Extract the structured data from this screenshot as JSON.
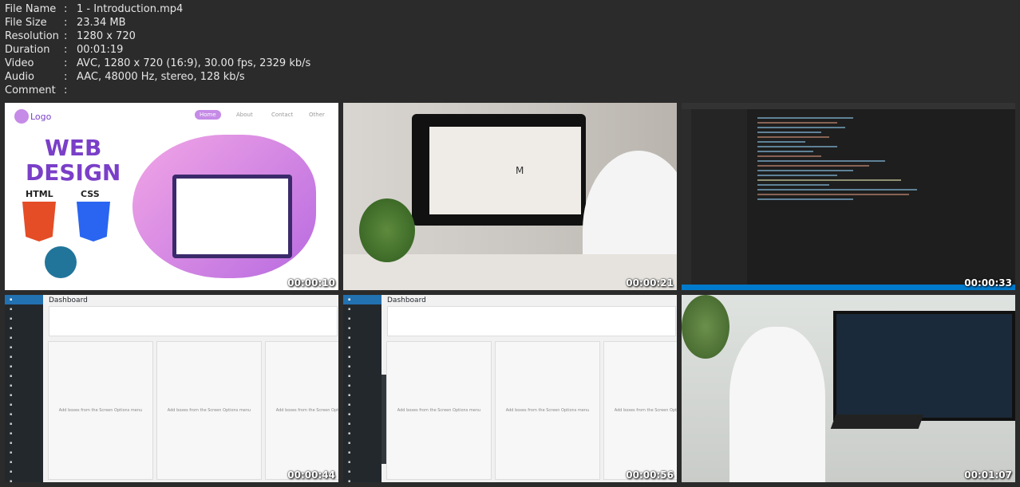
{
  "info": [
    {
      "key": "File Name",
      "value": "1 - Introduction.mp4"
    },
    {
      "key": "File Size",
      "value": "23.34 MB"
    },
    {
      "key": "Resolution",
      "value": "1280 x 720"
    },
    {
      "key": "Duration",
      "value": "00:01:19"
    },
    {
      "key": "Video",
      "value": "AVC, 1280 x 720 (16:9), 30.00 fps, 2329 kb/s"
    },
    {
      "key": "Audio",
      "value": "AAC, 48000 Hz, stereo, 128 kb/s"
    },
    {
      "key": "Comment",
      "value": ""
    }
  ],
  "separator": ":",
  "thumbs": [
    {
      "time": "00:00:10",
      "logo": "Logo",
      "nav": [
        "Home",
        "About",
        "Contact",
        "Other"
      ],
      "title1": "WEB",
      "title2": "DESIGN",
      "tag1": "HTML",
      "tag2": "CSS"
    },
    {
      "time": "00:00:21",
      "screen_letter": "M"
    },
    {
      "time": "00:00:33"
    },
    {
      "time": "00:00:44",
      "heading": "Dashboard",
      "empty": "Add boxes from the Screen Options menu"
    },
    {
      "time": "00:00:56",
      "heading": "Dashboard",
      "empty": "Add boxes from the Screen Options menu"
    },
    {
      "time": "00:01:07"
    }
  ]
}
